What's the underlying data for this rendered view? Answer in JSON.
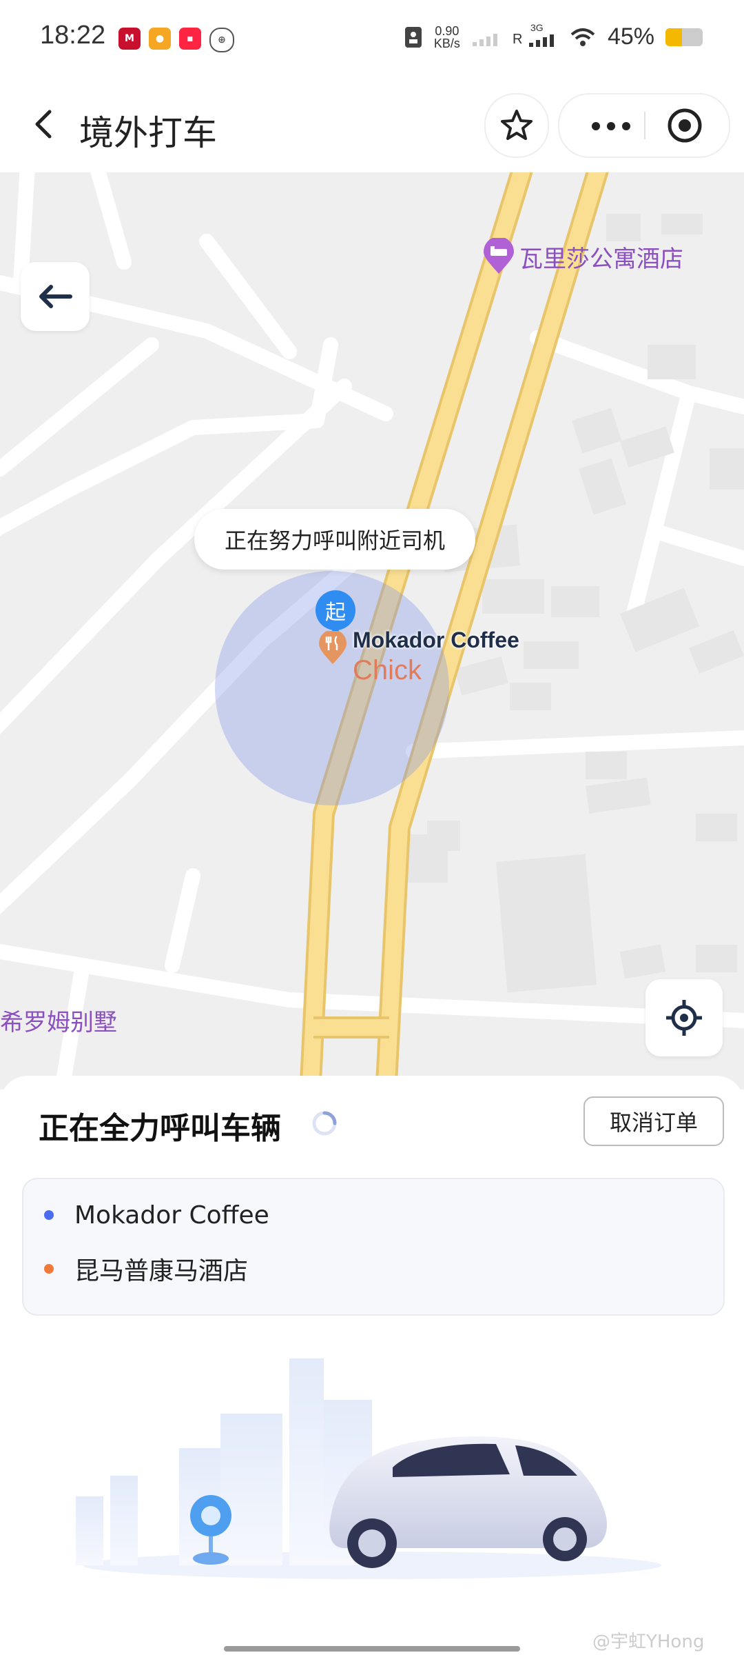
{
  "status_bar": {
    "time": "18:22",
    "net_speed_value": "0.90",
    "net_speed_unit": "KB/s",
    "network_type": "3G",
    "roaming": "R",
    "battery_percent": "45%",
    "battery_level": 0.45
  },
  "header": {
    "back_icon": "chevron-left-icon",
    "title": "境外打车",
    "favorite_icon": "star-icon",
    "more_icon": "more-dots-icon",
    "close_icon": "target-circle-icon"
  },
  "map": {
    "back_icon": "arrow-left-icon",
    "hotel_label": "瓦里莎公寓酒店",
    "villa_label": "希罗姆别墅",
    "calling_bubble": "正在努力呼叫附近司机",
    "start_pin_label": "起",
    "origin_poi_label": "Mokador Coffee",
    "nearby_poi_label": "Chick",
    "locate_icon": "locate-crosshair-icon",
    "road_color": "#f5d98a",
    "pulse_color": "#8296eb"
  },
  "order": {
    "status_text": "正在全力呼叫车辆",
    "cancel_label": "取消订单",
    "pickup": "Mokador Coffee",
    "pickup_dot_color": "#4a6cf0",
    "destination": "昆马普康马酒店",
    "destination_dot_color": "#f07a3a"
  },
  "footer": {
    "watermark": "@宇虹YHong"
  }
}
